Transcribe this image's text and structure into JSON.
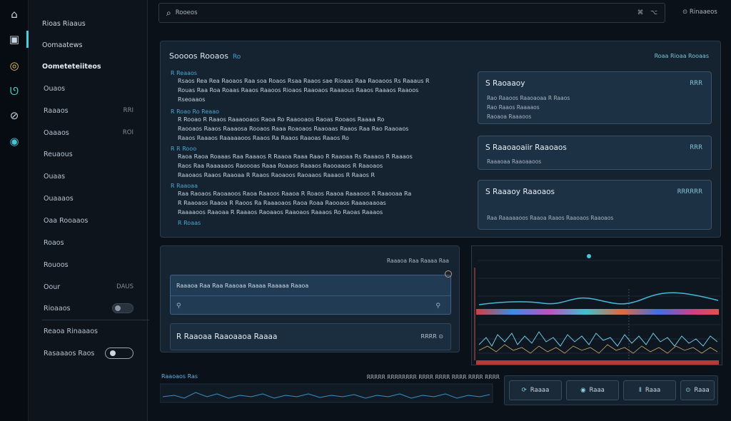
{
  "rail": {
    "icons": [
      "home-icon",
      "chip-icon",
      "layers-icon",
      "flow-icon",
      "link-icon",
      "globe-icon"
    ]
  },
  "sidebar": {
    "items": [
      {
        "label": "Rioas Riaaus",
        "badge": ""
      },
      {
        "label": "Oomaatews",
        "badge": ""
      },
      {
        "label": "Oometeteiiteos",
        "badge": ""
      },
      {
        "label": "Ouaos",
        "badge": ""
      },
      {
        "label": "Raaaos",
        "badge": "RRI"
      },
      {
        "label": "Oaaaos",
        "badge": "ROI"
      },
      {
        "label": "Reuaous",
        "badge": ""
      },
      {
        "label": "Ouaas",
        "badge": ""
      },
      {
        "label": "Ouaaaos",
        "badge": ""
      },
      {
        "label": "Oaa Rooaaos",
        "badge": ""
      },
      {
        "label": "Roaos",
        "badge": ""
      },
      {
        "label": "Rouoos",
        "badge": ""
      },
      {
        "label": "Oour",
        "badge": "DAUS"
      },
      {
        "label": "Rioaaos",
        "badge": ""
      }
    ],
    "footer": [
      "Reaoa Rinaaaos",
      "Rasaaaos Raos"
    ]
  },
  "search": {
    "value": "Rooeos",
    "kbd1": "⌘",
    "kbd2": "⌥"
  },
  "top_right": "Rinaaeos",
  "main": {
    "title": "Soooos Rooaos",
    "tag": "Ro",
    "meta": "Roaa Rioaa Rooaas",
    "logs": [
      {
        "head": "R  Reaaos",
        "lines": [
          "Rsaos Rea Rea Raoaos Raa soa Roaos Rsaa Raaos sae Rioaas Raa Raoaoos Rs Raaaus R",
          "Rouas Raa Roa Roaas Raaos Raaoos Rioaos Raaoaos Raaaous Raaos Raaaos  Raaoos",
          "Rseoaaos"
        ]
      },
      {
        "head": "R Roao Ro Reaao",
        "lines": [
          "R Rooao R Raaos Raaaooaos Raoa Ro Raaooaos Raoas Rooaos Raaaa Ro",
          "Raooaos Raaos Raaaosa Rooaos Raaa Roaoaos Raaoaas Raaos Raa Rao Raaoaos",
          "Raaos Raaaos Raaaaaoos Raaos Ra Raaos Raaoas Raaos Ro"
        ]
      },
      {
        "head": "R  R Rooo",
        "lines": [
          "Raoa Raoa Roaaas Raa Raaaos R Raaoa Raaa Raao R Raaoaa Rs Raaaos R Raaaos",
          "Raos  Raa Raaaaaos Raoooas Raaa Roaaos Raaaos Raooaaos  R Raaoaos",
          "Raaoaos Raaos Raaoaa R Raaos Raoaoos Raoaaos Raaaos R Raaos R"
        ]
      },
      {
        "head": "R  Raaoaa",
        "lines": [
          "Raa Raoaos Raoaaoos Raoa Raaoos Raaoa R Roaos Raaoa Raaaoos R Raaooaa Ra",
          "R Raaoaos Raaoa R Raoos Ra Raaaoaos Raoa Roaa Raooaos Raaaoaaoas",
          "Raaaaoos Raaoaa R Raaaos Raoaaos Raaoaos Raaaos Ro Raoas Raaaos"
        ]
      }
    ],
    "footer": "R  Roaas",
    "cards": [
      {
        "title": "S Raoaaoy",
        "value": "RRR",
        "subs": [
          "Rao Raaoos    Raaoaoaa R Raaos",
          "Rao Raaos Raaaaos",
          "Raoaoa Raaaoos"
        ]
      },
      {
        "title": "S Raaoaoaiir Raaoaos",
        "value": "RRR",
        "subs": [
          "Raaaoaa Raaoaaoos"
        ]
      },
      {
        "title": "S Raaaoy Raaoaos",
        "value": "RRRRRR",
        "subs": [
          "Raa Raaaaaoos Raaoa Raaos Raaoaos Raaoaos"
        ]
      }
    ]
  },
  "mid": {
    "label": "Raaaoa Raa Raaaa Raa",
    "message": "Raaaoa Raa Raa Raaoaa Raaaa Raaaaa Raaoa",
    "action_label": "R Raaoaa Raaoaaoa Raaaa",
    "action_value": "RRRR"
  },
  "bottom": {
    "title": "Raaoaos Ras",
    "stats": "RRRRR RRRRRRRR RRRR RRRR RRRR RRRR RRRR"
  },
  "buttons": [
    {
      "icon": "⟳",
      "label": "Raaaa"
    },
    {
      "icon": "◉",
      "label": "Raaa"
    },
    {
      "icon": "Ⅱ",
      "label": "Raaa"
    },
    {
      "icon": "⊙",
      "label": "Raaa"
    }
  ]
}
